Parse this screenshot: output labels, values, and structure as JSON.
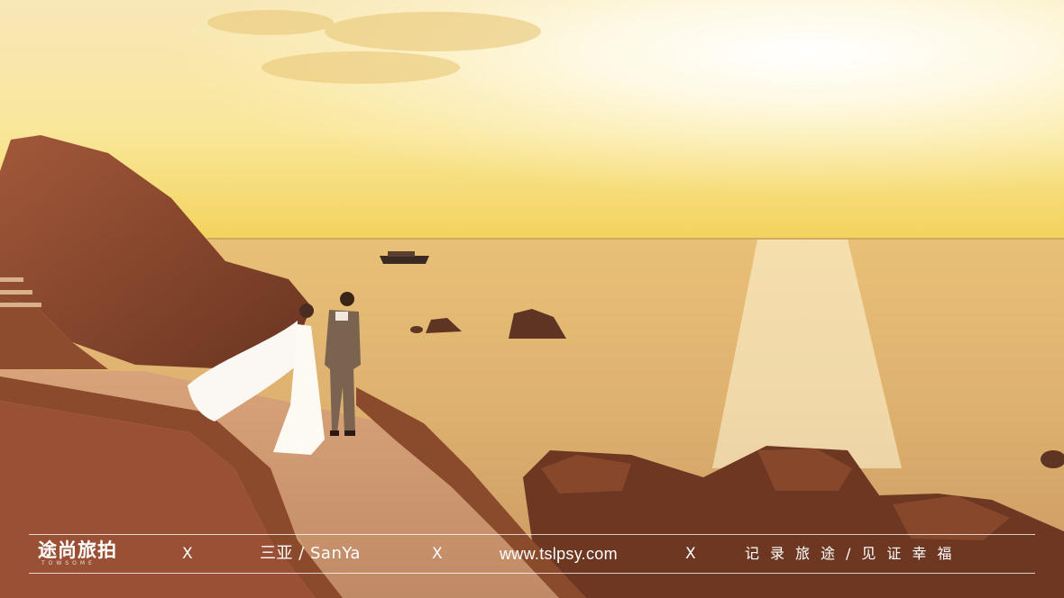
{
  "footer": {
    "brand_name": "途尚旅拍",
    "brand_sub": "TOWSOME",
    "separator": "X",
    "location": "三亚 / SanYa",
    "website": "www.tslpsy.com",
    "slogan": "记录旅途/见证幸福"
  },
  "colors": {
    "sky_bright": "#fff9e6",
    "sky_warm": "#f7d96a",
    "sea_gold": "#e8b05a",
    "rock_brown": "#8a4a2a",
    "text": "#ffffff"
  }
}
